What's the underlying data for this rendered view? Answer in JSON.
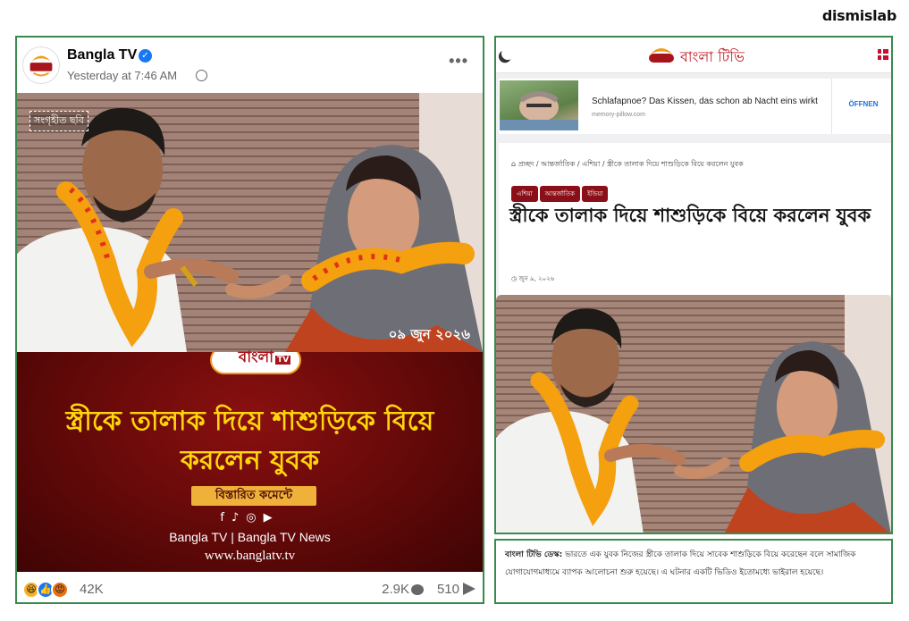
{
  "brand": "dismislab",
  "facebook_post": {
    "page_name": "Bangla TV",
    "verified": true,
    "timestamp": "Yesterday at 7:46 AM",
    "more_label": "•••",
    "photo": {
      "tag": "সংগৃহীত ছবি",
      "date": "০৯ জুন ২০২৬"
    },
    "banner": {
      "logo_text": "বাংলা",
      "logo_sub": "TV",
      "headline_line1": "স্ত্রীকে তালাক দিয়ে শাশুড়িকে বিয়ে",
      "headline_line2": "করলেন যুবক",
      "cta": "বিস্তারিত কমেন্টে",
      "social_icons": [
        "facebook-icon",
        "tiktok-icon",
        "instagram-icon",
        "youtube-icon"
      ],
      "pages": "Bangla TV | Bangla TV News",
      "url": "www.banglatv.tv"
    },
    "footer": {
      "reaction_count": "42K",
      "comment_count": "2.9K",
      "share_count": "510"
    }
  },
  "website": {
    "site_name": "বাংলা টিভি",
    "ad": {
      "title": "Schlafapnoe? Das Kissen, das schon ab Nacht eins wirkt",
      "domain": "memory-pillow.com",
      "button": "ÖFFNEN"
    },
    "breadcrumb": "প্রচ্ছদ / আন্তর্জাতিক / এশিয়া / স্ত্রীকে তালাক দিয়ে শাশুড়িকে বিয়ে করলেন যুবক",
    "tags": [
      "এশিয়া",
      "আন্তর্জাতিক",
      "ইন্ডিয়া"
    ],
    "title": "স্ত্রীকে তালাক দিয়ে শাশুড়িকে বিয়ে করলেন যুবক",
    "date": "জুন ৯, ২০২৬"
  },
  "desk_note": {
    "label": "বাংলা টিভি ডেস্ক:",
    "text": "ভারতে এক যুবক নিজের স্ত্রীকে তালাক দিয়ে সাবেক শাশুড়িকে বিয়ে করেছেন বলে সামাজিক যোগাযোগমাধ্যমে ব্যাপক আলোচনা শুরু হয়েছে। এ ঘটনার একটি ভিডিও ইতোমধ্যে ভাইরাল হয়েছে।"
  },
  "colors": {
    "frame": "#3a8a4e",
    "banner_red": "#6e0a0a",
    "headline_yellow": "#ffd60a",
    "fb_blue": "#1877f2",
    "site_red": "#c0141b"
  }
}
